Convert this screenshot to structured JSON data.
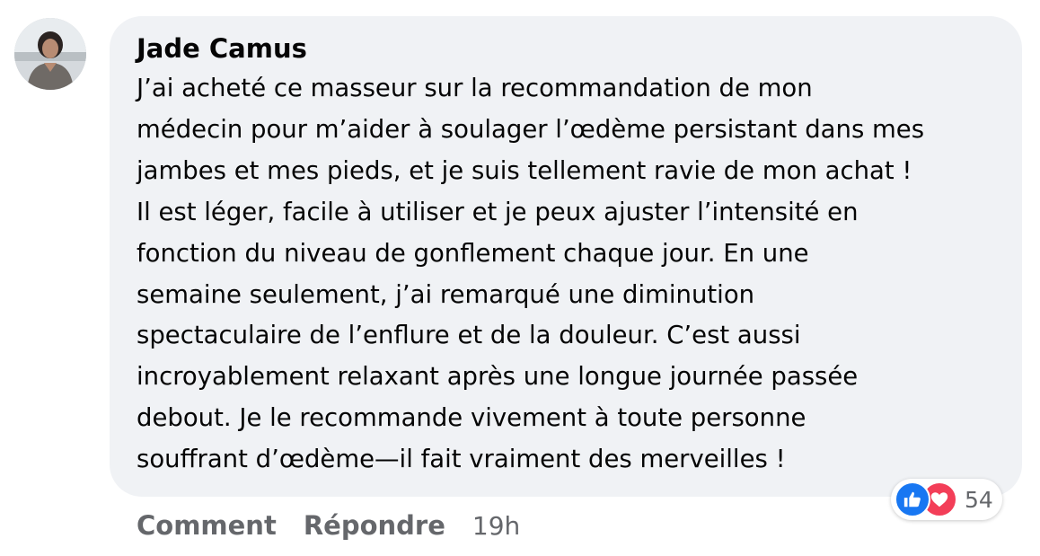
{
  "comment": {
    "author": "Jade Camus",
    "text_lines": [
      "J’ai acheté ce masseur sur la recommandation de mon",
      "médecin pour m’aider à soulager l’œdème persistant dans mes",
      "jambes et mes pieds, et je suis tellement ravie de mon achat !",
      "Il est léger, facile à utiliser et je peux ajuster l’intensité en",
      "fonction du niveau de gonflement chaque jour. En une",
      "semaine seulement, j’ai remarqué une diminution",
      "spectaculaire de l’enflure et de la douleur. C’est aussi",
      "incroyablement relaxant après une longue journée passée",
      "debout. Je le recommande vivement à toute personne",
      "souffrant d’œdème—il fait vraiment des merveilles !"
    ]
  },
  "reactions": {
    "icons": [
      "like-icon",
      "love-icon"
    ],
    "count": "54",
    "colors": {
      "like": "#1877f2",
      "love": "#f33e58"
    }
  },
  "actions": {
    "comment_label": "Comment",
    "reply_label": "Répondre",
    "timestamp": "19h"
  },
  "colors": {
    "bubble_bg": "#f0f2f5",
    "text": "#050505",
    "secondary_text": "#65676b"
  }
}
